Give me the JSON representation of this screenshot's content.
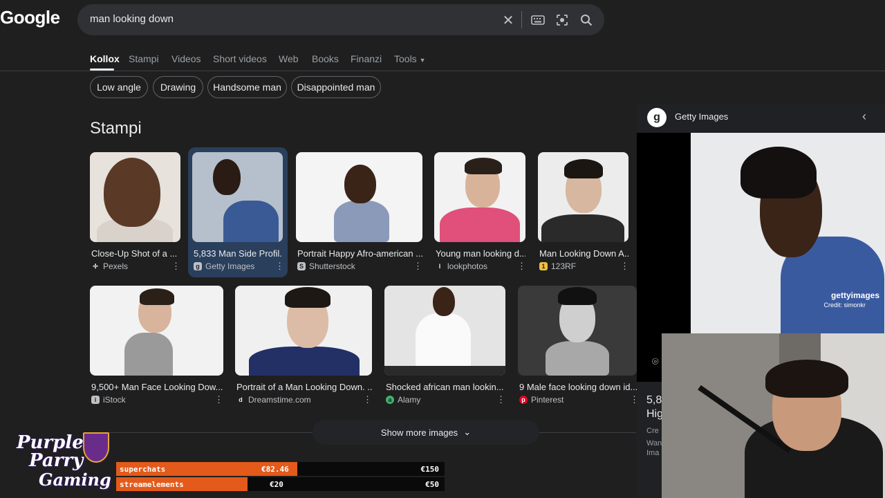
{
  "header": {
    "logo": "Google",
    "search_value": "man looking down",
    "icons": [
      "close-icon",
      "keyboard-icon",
      "lens-icon",
      "search-icon"
    ]
  },
  "tabs": [
    {
      "label": "Kollox",
      "active": true
    },
    {
      "label": "Stampi"
    },
    {
      "label": "Videos"
    },
    {
      "label": "Short videos"
    },
    {
      "label": "Web"
    },
    {
      "label": "Books"
    },
    {
      "label": "Finanzi"
    },
    {
      "label": "Tools"
    }
  ],
  "chips": [
    "Low angle",
    "Drawing",
    "Handsome man",
    "Disappointed man"
  ],
  "section_title": "Stampi",
  "images_row1": [
    {
      "title": "Close-Up Shot of a ...",
      "source": "Pexels",
      "icon": "P"
    },
    {
      "title": "5,833 Man Side Profil...",
      "source": "Getty Images",
      "icon": "g"
    },
    {
      "title": "Portrait Happy Afro-american ...",
      "source": "Shutterstock",
      "icon": "S"
    },
    {
      "title": "Young man looking d...",
      "source": "lookphotos",
      "icon": "l"
    },
    {
      "title": "Man Looking Down A...",
      "source": "123RF",
      "icon": "1"
    }
  ],
  "images_row2": [
    {
      "title": "9,500+ Man Face Looking Dow...",
      "source": "iStock",
      "icon": "i"
    },
    {
      "title": "Portrait of a Man Looking Down. ...",
      "source": "Dreamstime.com",
      "icon": "d"
    },
    {
      "title": "Shocked african man lookin...",
      "source": "Alamy",
      "icon": "a"
    },
    {
      "title": "9 Male face looking down id...",
      "source": "Pinterest",
      "icon": "p"
    }
  ],
  "show_more": "Show more images",
  "panel": {
    "source": "Getty Images",
    "watermark": "gettyimages",
    "credit": "Credit: simonkr",
    "title_partial": "5,8",
    "title_partial2": "Hig",
    "line_a": "Cre",
    "line_b": "Wan",
    "line_c": "Ima"
  },
  "overlay": {
    "brand_line1": "Purple",
    "brand_line2": "Parry",
    "brand_line3": "Gaming",
    "bars": [
      {
        "label": "superchats",
        "amount": "€82.46",
        "goal": "€150",
        "color": "#e35a1a"
      },
      {
        "label": "streamelements",
        "amount": "€20",
        "goal": "€50",
        "color": "#e35a1a"
      }
    ]
  }
}
